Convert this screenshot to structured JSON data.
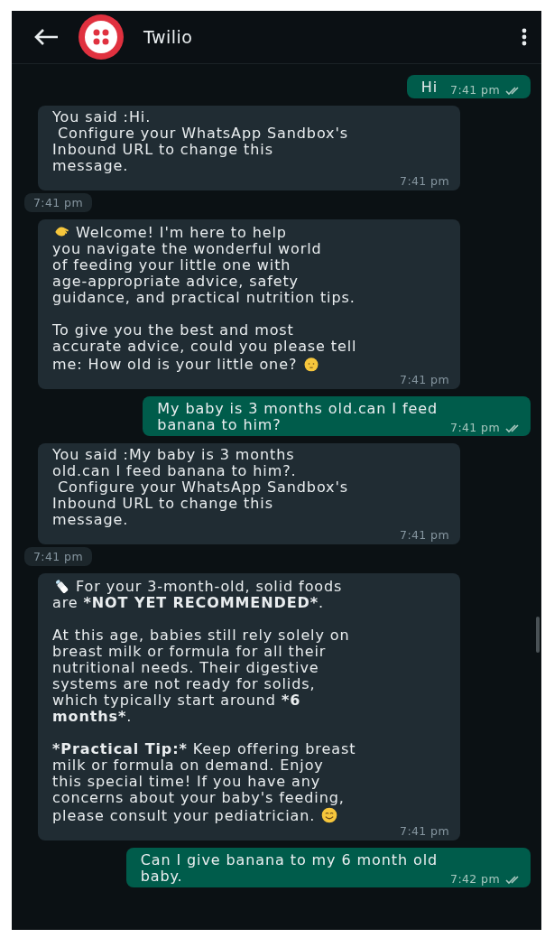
{
  "header": {
    "title": "Twilio"
  },
  "messages": [
    {
      "kind": "out",
      "paragraphs": [
        [
          {
            "kind": "text",
            "text": "Hi",
            "bold": false
          }
        ]
      ],
      "time": "7:41 pm",
      "read": false
    },
    {
      "kind": "in",
      "paragraphs": [
        [
          {
            "kind": "text",
            "text": "You said :Hi.\n Configure your WhatsApp Sandbox's\nInbound URL to change this\nmessage.",
            "bold": false
          }
        ]
      ],
      "time": "7:41 pm"
    },
    {
      "kind": "chip",
      "time": "7:41 pm"
    },
    {
      "kind": "in",
      "paragraphs": [
        [
          {
            "kind": "wave"
          },
          {
            "kind": "text",
            "text": " Welcome! I'm here to help\nyou navigate the wonderful world\nof feeding your little one with\nage-appropriate advice, safety\nguidance, and practical nutrition tips.",
            "bold": false
          }
        ],
        [
          {
            "kind": "text",
            "text": "To give you the best and most\naccurate advice, could you please tell\nme: How old is your little one? ",
            "bold": false
          },
          {
            "kind": "baby"
          }
        ]
      ],
      "time": "7:41 pm"
    },
    {
      "kind": "out",
      "paragraphs": [
        [
          {
            "kind": "text",
            "text": "My baby is 3 months old.can I feed\nbanana to him?",
            "bold": false
          }
        ]
      ],
      "time": "7:41 pm",
      "read": false
    },
    {
      "kind": "in",
      "paragraphs": [
        [
          {
            "kind": "text",
            "text": "You said :My baby is 3 months\nold.can I feed banana to him?.\n Configure your WhatsApp Sandbox's\nInbound URL to change this\nmessage.",
            "bold": false
          }
        ]
      ],
      "time": "7:41 pm"
    },
    {
      "kind": "chip",
      "time": "7:41 pm"
    },
    {
      "kind": "in",
      "paragraphs": [
        [
          {
            "kind": "bottle"
          },
          {
            "kind": "text",
            "text": " For your 3-month-old, solid foods\nare ",
            "bold": false
          },
          {
            "kind": "text",
            "text": "*NOT YET RECOMMENDED*",
            "bold": true
          },
          {
            "kind": "text",
            "text": ".",
            "bold": false
          }
        ],
        [
          {
            "kind": "text",
            "text": "At this age, babies still rely solely on\nbreast milk or formula for all their\nnutritional needs. Their digestive\nsystems are not ready for solids,\nwhich typically start around ",
            "bold": false
          },
          {
            "kind": "text",
            "text": "*6\nmonths*",
            "bold": true
          },
          {
            "kind": "text",
            "text": ".",
            "bold": false
          }
        ],
        [
          {
            "kind": "text",
            "text": "*Practical Tip:*",
            "bold": true
          },
          {
            "kind": "text",
            "text": " Keep offering breast\nmilk or formula on demand. Enjoy\nthis special time! If you have any\nconcerns about your baby's feeding,\nplease consult your pediatrician. ",
            "bold": false
          },
          {
            "kind": "smile"
          }
        ]
      ],
      "time": "7:41 pm"
    },
    {
      "kind": "out",
      "paragraphs": [
        [
          {
            "kind": "text",
            "text": "Can I give banana to my 6 month old\nbaby.",
            "bold": false
          }
        ]
      ],
      "time": "7:42 pm",
      "read": false
    }
  ]
}
